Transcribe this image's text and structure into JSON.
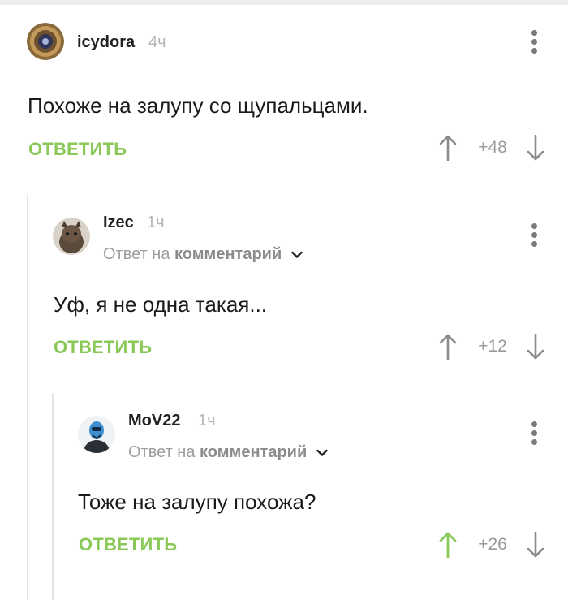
{
  "comments": [
    {
      "username": "icydora",
      "time": "4ч",
      "text": "Похоже на залупу со щупальцами.",
      "reply_label": "ОТВЕТИТЬ",
      "score": "+48"
    },
    {
      "username": "Izec",
      "time": "1ч",
      "reply_to_prefix": "Ответ на",
      "reply_to_link": "комментарий",
      "text": "Уф, я не одна такая...",
      "reply_label": "ОТВЕТИТЬ",
      "score": "+12"
    },
    {
      "username": "MoV22",
      "time": "1ч",
      "reply_to_prefix": "Ответ на",
      "reply_to_link": "комментарий",
      "text": "Тоже на залупу похожа?",
      "reply_label": "ОТВЕТИТЬ",
      "score": "+26"
    }
  ],
  "colors": {
    "accent_green": "#8ac858",
    "icon_gray": "#8a8a8a",
    "upvoted_green": "#8ac858"
  },
  "icons": [
    "more-vert-icon",
    "chevron-down-icon",
    "arrow-up-icon",
    "arrow-down-icon"
  ]
}
